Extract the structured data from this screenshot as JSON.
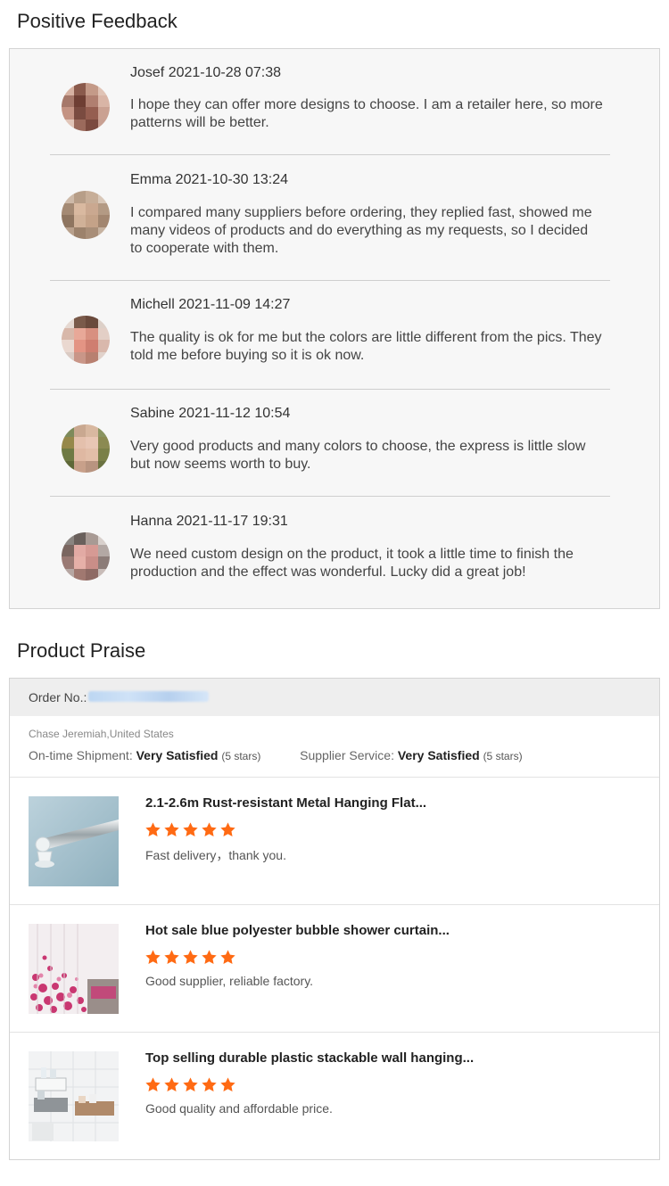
{
  "sections": {
    "feedback_title": "Positive Feedback",
    "praise_title": "Product Praise"
  },
  "feedback": [
    {
      "name_date": "Josef 2021-10-28 07:38",
      "text": "I hope they can offer more designs to choose. I am a retailer here, so more patterns will be better."
    },
    {
      "name_date": "Emma 2021-10-30 13:24",
      "text": "I compared many suppliers before ordering, they replied fast, showed me many videos of products and do everything as my requests, so I decided to cooperate with them."
    },
    {
      "name_date": "Michell 2021-11-09 14:27",
      "text": "The quality is ok for me but the colors are little different from the pics. They told me before buying so it is ok now."
    },
    {
      "name_date": "Sabine 2021-11-12 10:54",
      "text": "Very good products and many colors to choose, the express is little slow but now seems worth to buy."
    },
    {
      "name_date": "Hanna 2021-11-17 19:31",
      "text": "We need custom design on the product, it took a little time to finish the production and the effect was wonderful. Lucky did a great job!"
    }
  ],
  "order": {
    "label": "Order No.:",
    "buyer": "Chase Jeremiah,United States",
    "shipment_label": "On-time Shipment:",
    "shipment_value": "Very Satisfied",
    "shipment_stars": "(5 stars)",
    "service_label": "Supplier Service:",
    "service_value": "Very Satisfied",
    "service_stars": "(5 stars)"
  },
  "products": [
    {
      "title": "2.1-2.6m Rust-resistant Metal Hanging Flat...",
      "rating": 5,
      "review": "Fast delivery，thank you."
    },
    {
      "title": "Hot sale blue polyester bubble shower curtain...",
      "rating": 5,
      "review": "Good supplier, reliable factory."
    },
    {
      "title": "Top selling durable plastic stackable wall hanging...",
      "rating": 5,
      "review": "Good quality and affordable price."
    }
  ],
  "colors": {
    "star": "#ff6a13"
  }
}
